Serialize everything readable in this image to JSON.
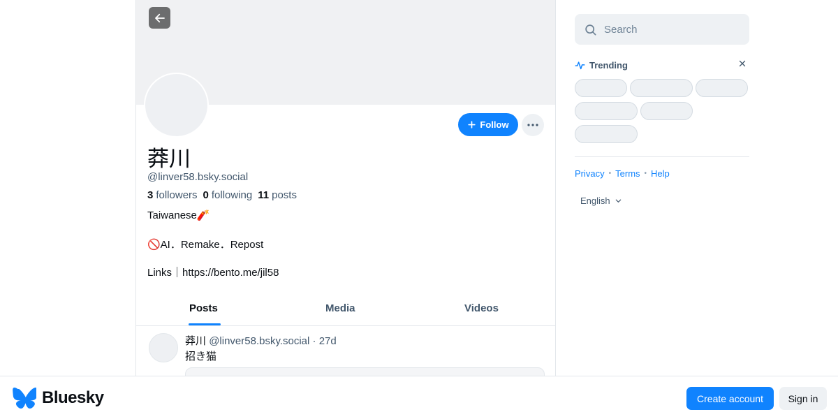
{
  "profile": {
    "display_name": "莽川",
    "handle": "@linver58.bsky.social",
    "stats": {
      "followers_count": "3",
      "followers_label": "followers",
      "following_count": "0",
      "following_label": "following",
      "posts_count": "11",
      "posts_label": "posts"
    },
    "bio": [
      "Taiwanese🧨",
      "🚫AI．Remake．Repost",
      "Links｜https://bento.me/jil58"
    ],
    "follow_label": "Follow"
  },
  "tabs": [
    {
      "label": "Posts",
      "active": true
    },
    {
      "label": "Media",
      "active": false
    },
    {
      "label": "Videos",
      "active": false
    }
  ],
  "post": {
    "author_name": "莽川",
    "author_handle": "@linver58.bsky.social",
    "separator": "·",
    "time": "27d",
    "text": "招き猫"
  },
  "sidebar": {
    "search_placeholder": "Search",
    "trending_title": "Trending",
    "links": [
      "Privacy",
      "Terms",
      "Help"
    ],
    "language": "English"
  },
  "bottom_bar": {
    "brand": "Bluesky",
    "create_account": "Create account",
    "sign_in": "Sign in"
  },
  "colors": {
    "accent": "#1083fe",
    "muted_text": "#42576c",
    "border": "#e3e7eb"
  }
}
